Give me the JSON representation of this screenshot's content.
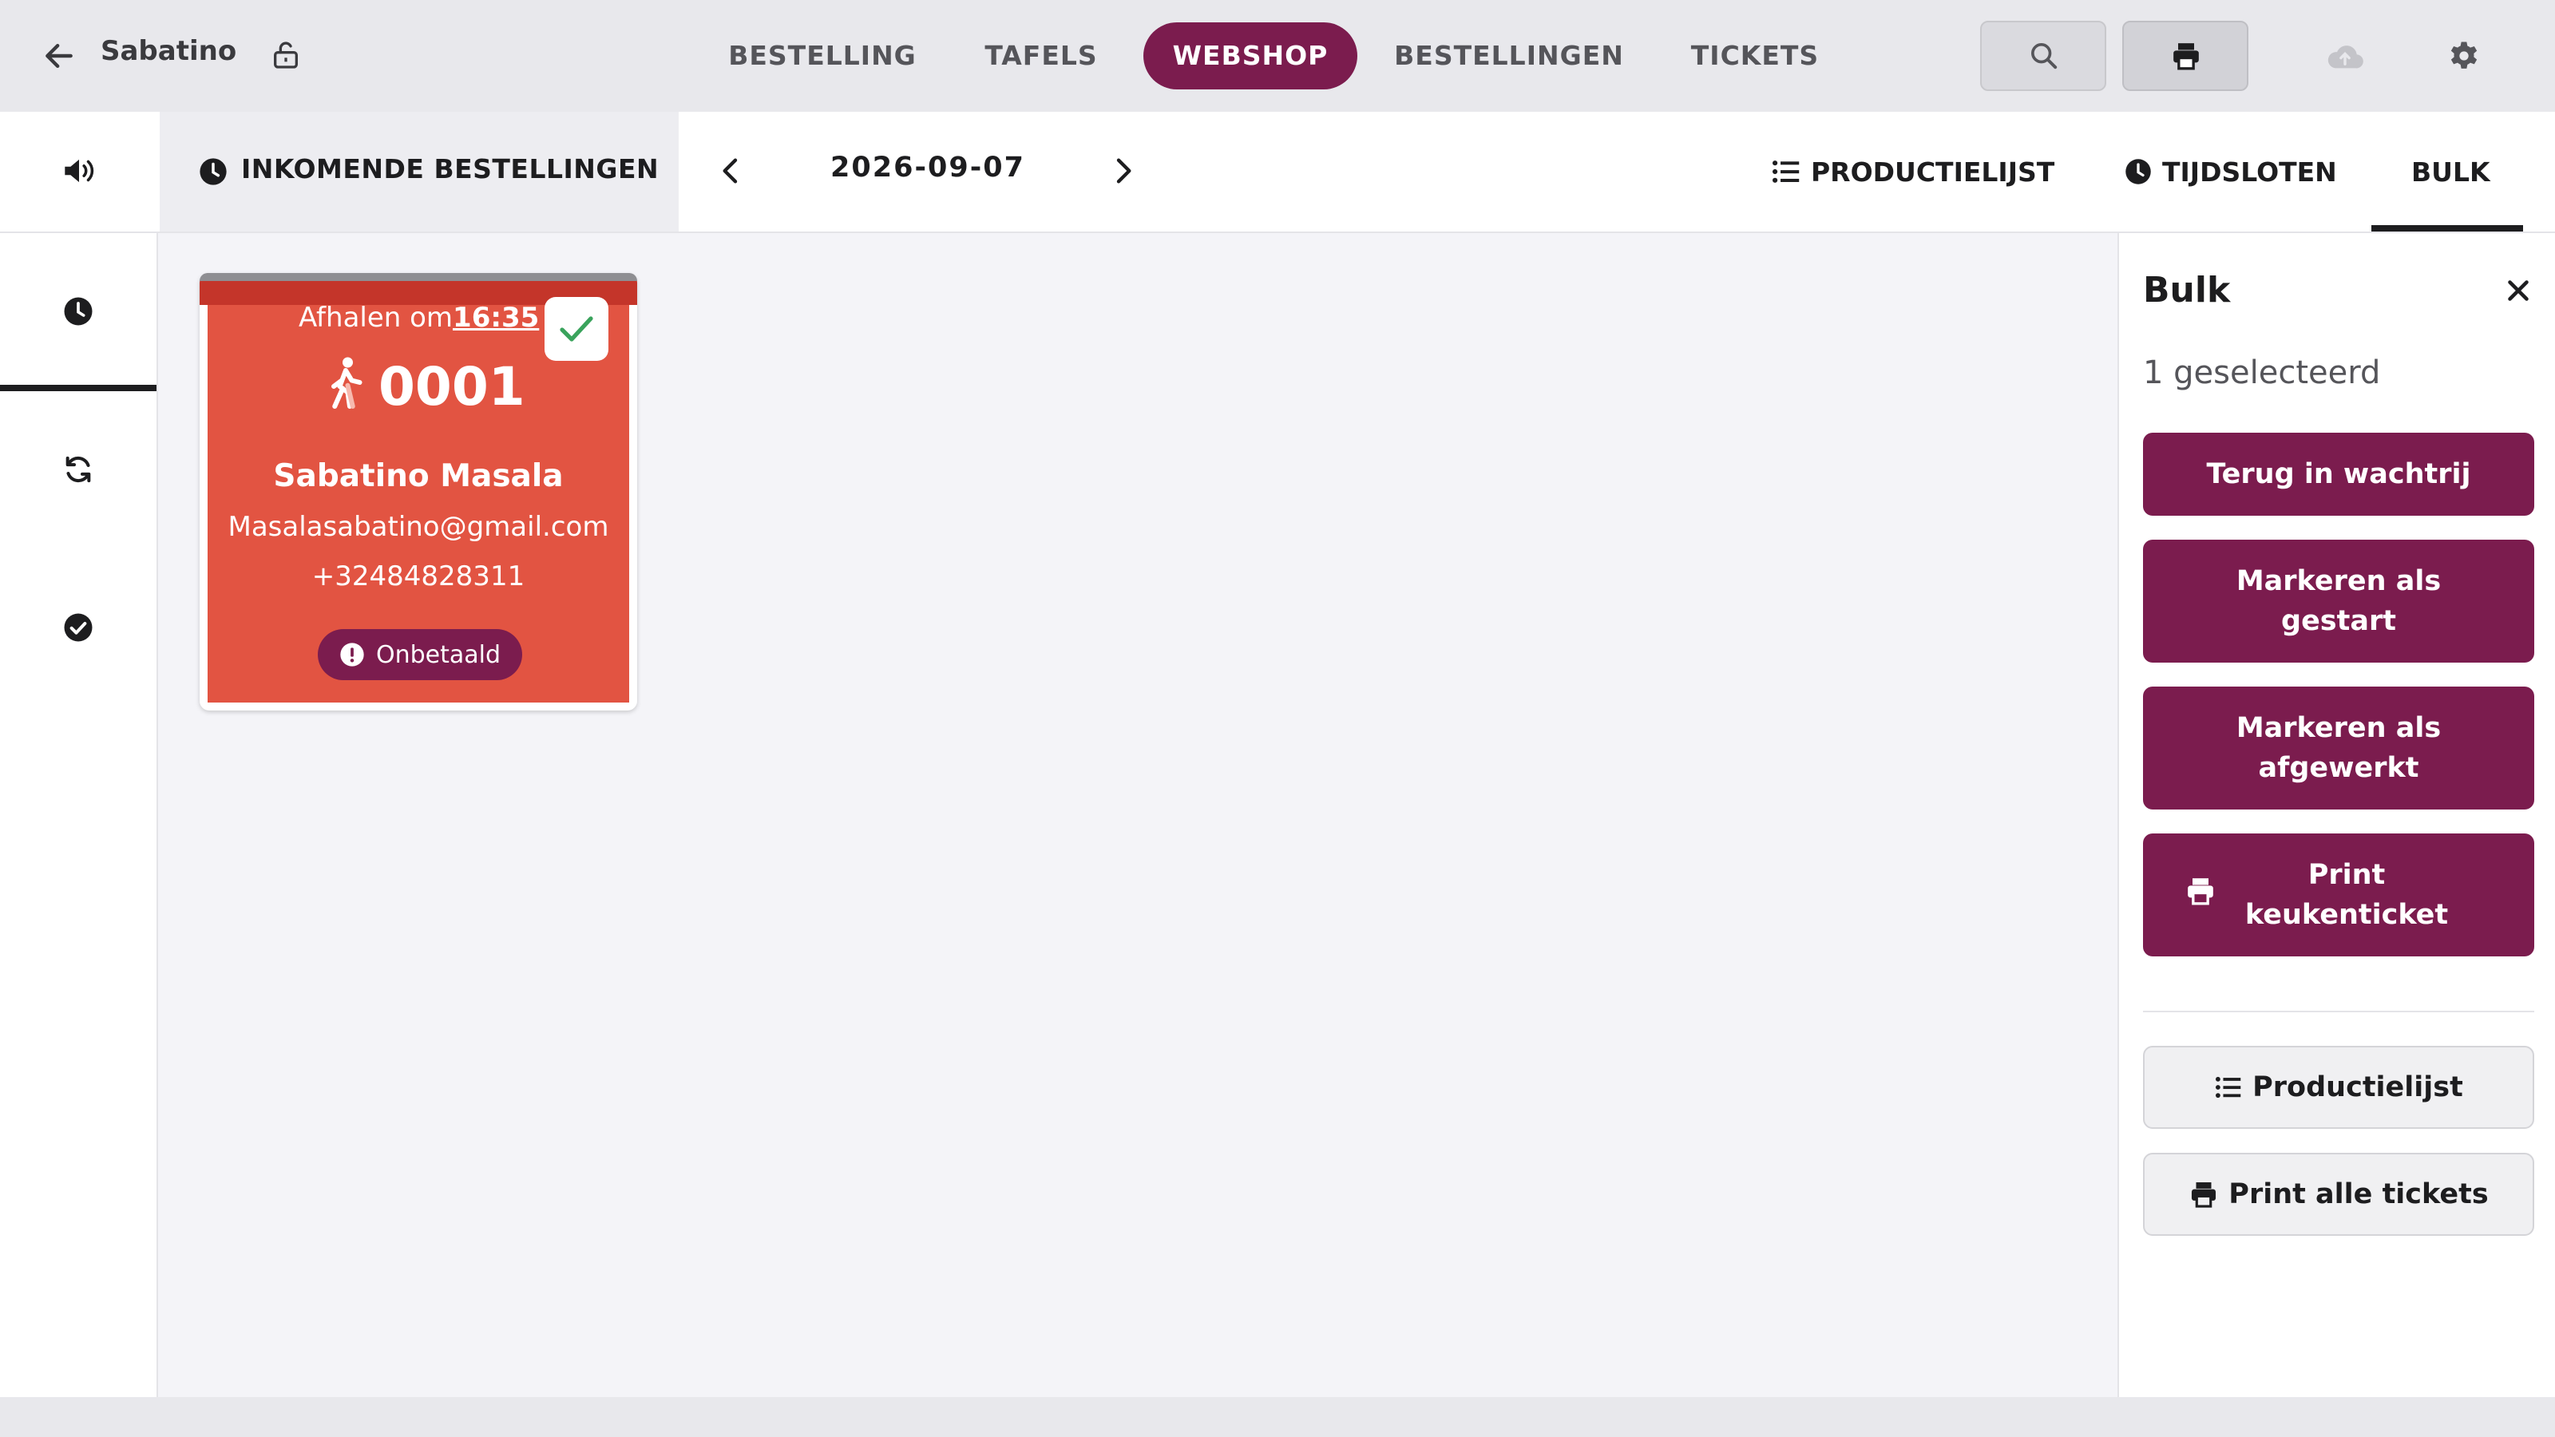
{
  "app": {
    "title": "Sabatino"
  },
  "nav": {
    "tabs": [
      {
        "label": "BESTELLING"
      },
      {
        "label": "TAFELS"
      },
      {
        "label": "WEBSHOP",
        "active": true
      },
      {
        "label": "BESTELLINGEN"
      },
      {
        "label": "TICKETS"
      }
    ]
  },
  "subnav": {
    "incoming_label": "INKOMENDE BESTELLINGEN",
    "date": "2026-09-07",
    "productlist_label": "PRODUCTIELIJST",
    "timeslots_label": "TIJDSLOTEN",
    "bulk_label": "BULK"
  },
  "order": {
    "pickup_prefix": "Afhalen om",
    "pickup_time": "16:35",
    "number": "0001",
    "customer_name": "Sabatino Masala",
    "email": "Masalasabatino@gmail.com",
    "phone": "+32484828311",
    "payment_status": "Onbetaald",
    "selected": true
  },
  "bulk": {
    "title": "Bulk",
    "selected_text": "1 geselecteerd",
    "actions": {
      "back_to_queue": "Terug in wachtrij",
      "mark_started": "Markeren als gestart",
      "mark_done": "Markeren als afgewerkt",
      "print_kitchen": "Print keukenticket"
    },
    "productlist_button": "Productielijst",
    "print_all_button": "Print alle tickets"
  },
  "colors": {
    "brand": "#7b1c4e",
    "order_card": "#e25442",
    "check": "#3aa35c"
  }
}
